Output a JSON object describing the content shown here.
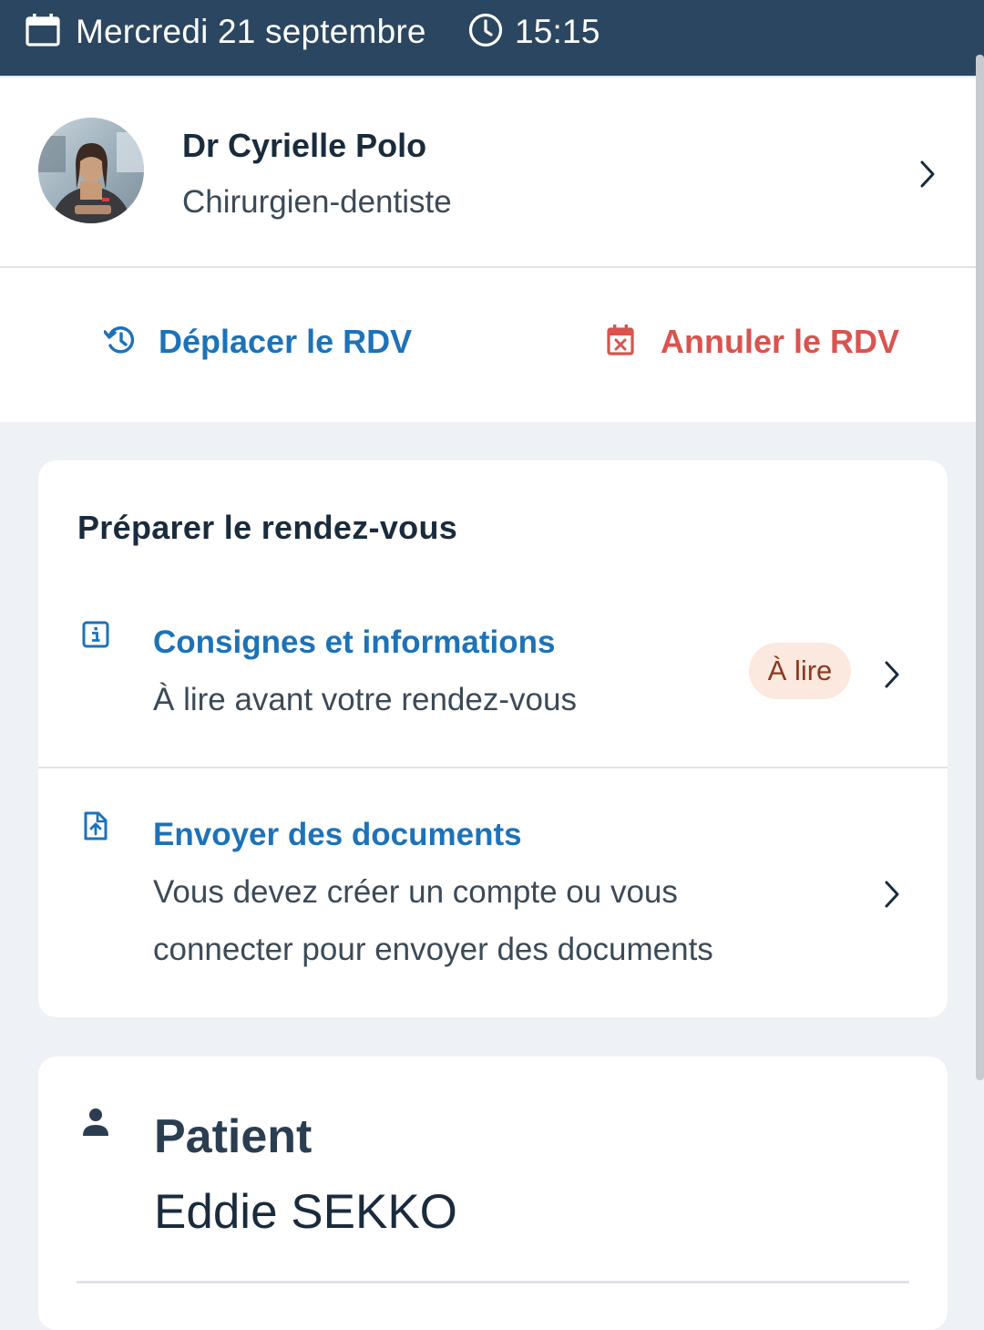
{
  "header": {
    "date": "Mercredi 21 septembre",
    "time": "15:15"
  },
  "doctor": {
    "name": "Dr Cyrielle Polo",
    "specialty": "Chirurgien-dentiste"
  },
  "actions": {
    "move_label": "Déplacer le RDV",
    "cancel_label": "Annuler le RDV"
  },
  "prepare": {
    "title": "Préparer le rendez-vous",
    "items": [
      {
        "title": "Consignes et informations",
        "subtitle": "À lire avant votre rendez-vous",
        "badge": "À lire"
      },
      {
        "title": "Envoyer des documents",
        "subtitle": "Vous devez créer un compte ou vous connecter pour envoyer des documents"
      }
    ]
  },
  "patient": {
    "label": "Patient",
    "name": "Eddie SEKKO"
  },
  "colors": {
    "header_bg": "#2b4660",
    "primary_blue": "#1d72b8",
    "cancel_red": "#d9534f",
    "badge_bg": "#fbe8df",
    "page_bg": "#eef1f5"
  },
  "icons": {
    "date": "calendar-icon",
    "time": "clock-icon",
    "move": "history-icon",
    "cancel": "calendar-cancel-icon",
    "info": "info-icon",
    "upload": "file-upload-icon",
    "patient": "person-icon",
    "chevron": "chevron-right-icon"
  }
}
